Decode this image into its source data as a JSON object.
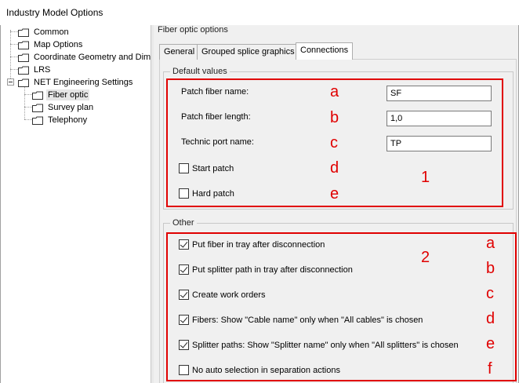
{
  "window": {
    "title": "Industry Model Options"
  },
  "tree": {
    "items": [
      {
        "label": "Common"
      },
      {
        "label": "Map Options"
      },
      {
        "label": "Coordinate Geometry and Dime"
      },
      {
        "label": "LRS"
      },
      {
        "label": "NET Engineering Settings"
      },
      {
        "label": "Fiber optic"
      },
      {
        "label": "Survey plan"
      },
      {
        "label": "Telephony"
      }
    ]
  },
  "main": {
    "section_title": "Fiber optic options",
    "tabs": [
      {
        "label": "General"
      },
      {
        "label": "Grouped splice graphics"
      },
      {
        "label": "Connections"
      }
    ],
    "default_values": {
      "title": "Default values",
      "fields": [
        {
          "label": "Patch fiber name:",
          "value": "SF",
          "anno": "a"
        },
        {
          "label": "Patch fiber length:",
          "value": "1,0",
          "anno": "b"
        },
        {
          "label": "Technic port name:",
          "value": "TP",
          "anno": "c"
        }
      ],
      "checkboxes": [
        {
          "label": "Start patch",
          "checked": false,
          "anno": "d"
        },
        {
          "label": "Hard patch",
          "checked": false,
          "anno": "e"
        }
      ],
      "group_anno": "1"
    },
    "other": {
      "title": "Other",
      "group_anno": "2",
      "checkboxes": [
        {
          "label": "Put fiber in tray after disconnection",
          "checked": true,
          "anno": "a"
        },
        {
          "label": "Put splitter path in tray after disconnection",
          "checked": true,
          "anno": "b"
        },
        {
          "label": "Create work orders",
          "checked": true,
          "anno": "c"
        },
        {
          "label": "Fibers: Show \"Cable name\" only when \"All cables\" is chosen",
          "checked": true,
          "anno": "d"
        },
        {
          "label": "Splitter paths: Show \"Splitter name\" only when \"All splitters\" is chosen",
          "checked": true,
          "anno": "e"
        },
        {
          "label": "No auto selection in separation actions",
          "checked": false,
          "anno": "f"
        }
      ]
    }
  },
  "colors": {
    "annotation": "#e00000",
    "panel_bg": "#f0f0f0"
  },
  "icons": {
    "tree_node": "folder-icon",
    "expander": "collapse-icon"
  }
}
